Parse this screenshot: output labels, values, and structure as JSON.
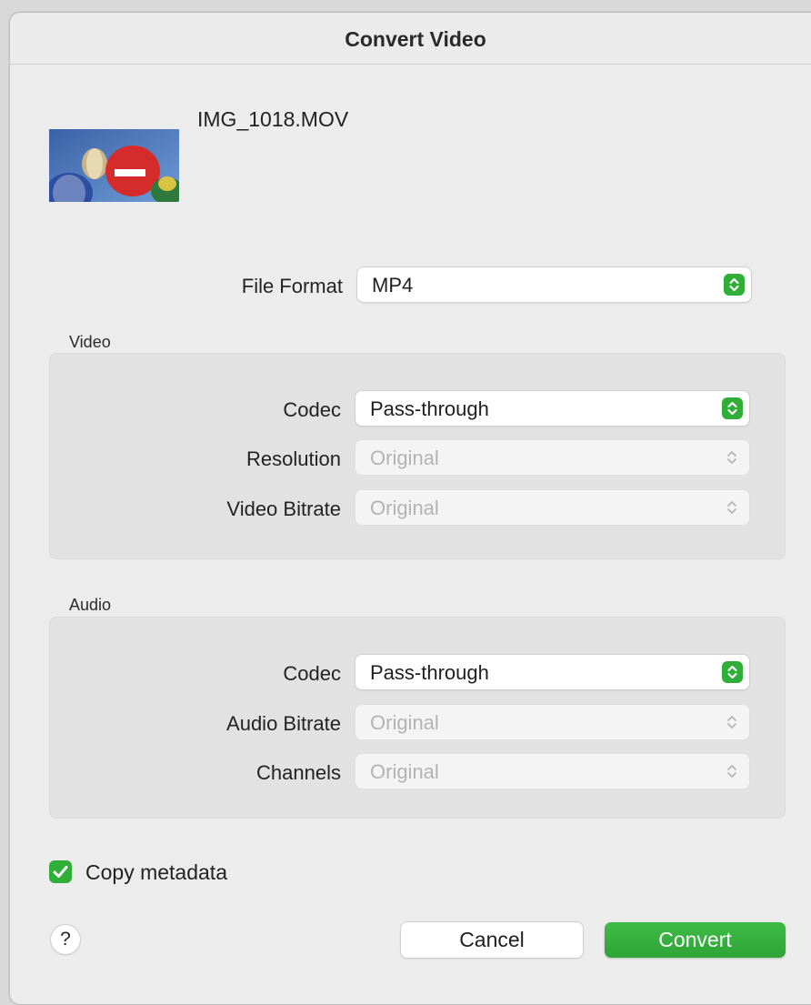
{
  "window": {
    "title": "Convert Video"
  },
  "file": {
    "name": "IMG_1018.MOV"
  },
  "format": {
    "label": "File Format",
    "value": "MP4"
  },
  "video": {
    "title": "Video",
    "codec_label": "Codec",
    "codec_value": "Pass-through",
    "resolution_label": "Resolution",
    "resolution_value": "Original",
    "bitrate_label": "Video Bitrate",
    "bitrate_value": "Original"
  },
  "audio": {
    "title": "Audio",
    "codec_label": "Codec",
    "codec_value": "Pass-through",
    "bitrate_label": "Audio Bitrate",
    "bitrate_value": "Original",
    "channels_label": "Channels",
    "channels_value": "Original"
  },
  "options": {
    "copy_metadata_label": "Copy metadata",
    "copy_metadata_checked": true
  },
  "buttons": {
    "help_label": "?",
    "cancel_label": "Cancel",
    "convert_label": "Convert"
  },
  "colors": {
    "accent": "#2fae38",
    "window_bg": "#ececec",
    "group_bg": "#e2e2e2"
  },
  "icons": {
    "thumbnail": "video-thumbnail-hot-air-balloons",
    "enabled_popup": "green-up-down-chevrons-icon",
    "disabled_popup": "gray-up-down-chevrons-icon",
    "checkbox": "checkmark-icon"
  }
}
